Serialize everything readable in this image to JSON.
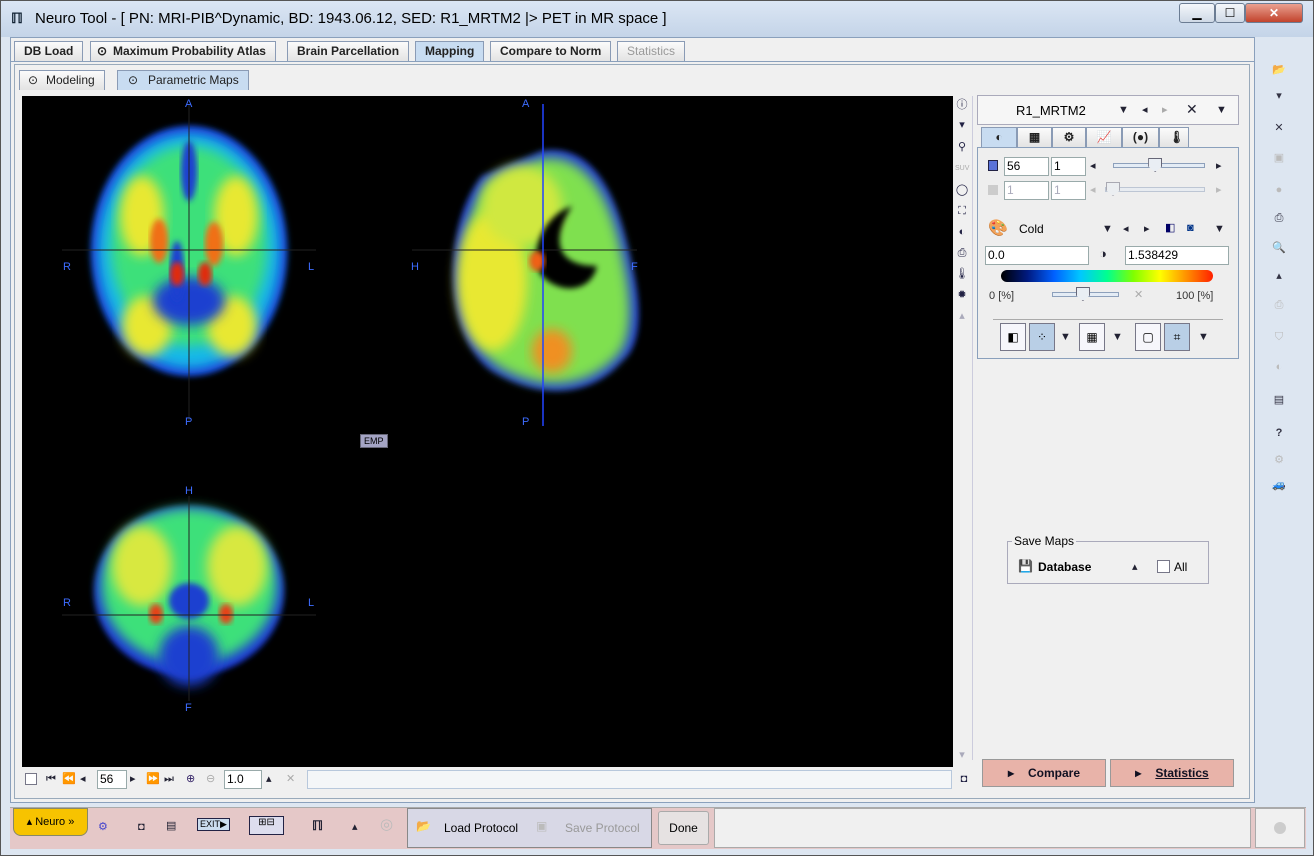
{
  "window": {
    "title": "Neuro Tool - [ PN: MRI-PIB^Dynamic, BD: 1943.06.12, SED: R1_MRTM2 |> PET in MR space ]",
    "minimize": "▁",
    "maximize": "☐",
    "close": "✕"
  },
  "main_tabs": [
    {
      "label": "DB Load",
      "state": "normal"
    },
    {
      "label": "Maximum Probability Atlas",
      "state": "normal"
    },
    {
      "label": "Brain Parcellation",
      "state": "normal"
    },
    {
      "label": "Mapping",
      "state": "active"
    },
    {
      "label": "Compare to Norm",
      "state": "normal"
    },
    {
      "label": "Statistics",
      "state": "disabled"
    }
  ],
  "sub_tabs": [
    {
      "label": "Modeling"
    },
    {
      "label": "Parametric Maps",
      "active": true
    }
  ],
  "viewer": {
    "orientation_labels": {
      "axial": [
        "A",
        "P",
        "R",
        "L"
      ],
      "sagittal": [
        "A",
        "P",
        "H",
        "F"
      ],
      "coronal": [
        "H",
        "F",
        "R",
        "L"
      ]
    },
    "emp_label": "EMP",
    "colormap_note": "rainbow/cold-like"
  },
  "viewer_toolbar": {
    "slice": "56",
    "zoom": "1.0"
  },
  "right_panel": {
    "series": "R1_MRTM2",
    "slice_value": "56",
    "slice_step": "1",
    "frame_value": "1",
    "frame_step": "1",
    "slice_slider": 0.45,
    "frame_slider": 0.0,
    "colormap": "Cold",
    "min": "0.0",
    "max": "1.538429",
    "lower_pct": "0",
    "upper_pct": "100",
    "pct_unit": "[%]",
    "threshold_slider": 0.45
  },
  "save_maps": {
    "legend": "Save Maps",
    "target": "Database",
    "all_label": "All",
    "all_checked": false
  },
  "buttons": {
    "compare": "Compare",
    "statistics": "Statistics"
  },
  "bottom": {
    "neuro": "Neuro »",
    "load_protocol": "Load Protocol",
    "save_protocol": "Save Protocol",
    "done": "Done"
  },
  "colors": {
    "accent_tab": "#c8dcf1",
    "pink_button": "#e8b3a9",
    "neuro_button": "#f7c300",
    "bottom_bar": "#e5c8c8"
  }
}
